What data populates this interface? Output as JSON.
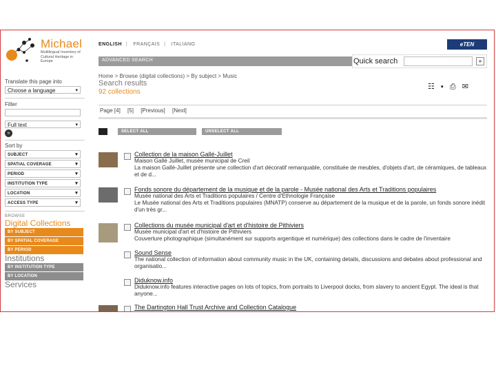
{
  "logo": {
    "name": "Michael",
    "tagline": "Multilingual Inventory of Cultural Heritage in Europe"
  },
  "languages": [
    {
      "label": "ENGLISH",
      "active": true
    },
    {
      "label": "FRANÇAIS",
      "active": false
    },
    {
      "label": "ITALIANO",
      "active": false
    }
  ],
  "header": {
    "advanced_search": "ADVANCED SEARCH",
    "eten_logo": "eTEN"
  },
  "quick_search": {
    "label": "Quick search",
    "button": "»"
  },
  "sidebar": {
    "translate_label": "Translate this page into",
    "language_select": "Choose a language",
    "filter_label": "Filter",
    "filter_select": "Full text",
    "go": "»",
    "sort_label": "Sort by",
    "sort_options": [
      "SUBJECT",
      "SPATIAL COVERAGE",
      "PERIOD",
      "INSTITUTION TYPE",
      "LOCATION",
      "ACCESS TYPE"
    ],
    "browse_label": "BROWSE",
    "digital_collections": "Digital Collections",
    "dc_buttons": [
      "BY SUBJECT",
      "BY SPATIAL COVERAGE",
      "BY PERIOD"
    ],
    "institutions": "Institutions",
    "inst_buttons": [
      "BY INSTITUTION TYPE",
      "BY LOCATION"
    ],
    "services": "Services"
  },
  "breadcrumb": "Home > Browse (digital collections) > By subject > Music",
  "results": {
    "title": "Search results",
    "count": "92 collections",
    "pager": [
      "Page [4]",
      "[5]",
      "[Previous]",
      "[Next]"
    ],
    "select_all": "SELECT ALL",
    "unselect_all": "UNSELECT ALL",
    "tools": "☷ ▪ ⎙ ✉",
    "items": [
      {
        "title": "Collection de la maison Gallé-Juillet",
        "line1": "Maison Gallé Juillet, musée municipal de Creil",
        "line2": "La maison Gallé-Juillet présente une collection d'art décoratif remarquable, constituée de meubles, d'objets d'art, de céramiques, de tableaux et de d...",
        "thumb": true
      },
      {
        "title": "Fonds sonore du département de la musique et de la parole - Musée national des Arts et Traditions populaires",
        "line1": "Musée national des Arts et Traditions populaires / Centre d'Ethnologie Française",
        "line2": "Le Musée national des Arts et Traditions populaires (MNATP) conserve au département de la musique et de la parole, un fonds sonore inédit d'un très gr...",
        "thumb": true
      },
      {
        "title": "Collections du musée municipal d'art et d'histoire de Pithiviers",
        "line1": "Musée municipal d'art et d'histoire de Pithiviers",
        "line2": "Couverture photographique (simultanément sur supports argentique et numérique) des collections dans le cadre de l'inventaire",
        "thumb": true
      },
      {
        "title": "Sound Sense",
        "line1": "The national collection of information about community music in the UK, containing details, discussions and debates about professional and organisatio...",
        "line2": "",
        "thumb": false
      },
      {
        "title": "Diduknow.info",
        "line1": "Diduknow.info features interactive pages on lots of topics, from portraits to Liverpool docks, from slavery to ancient Egypt. The ideal is that anyone...",
        "line2": "",
        "thumb": false
      },
      {
        "title": "The Dartington Hall Trust Archive and Collection Catalogue",
        "line1": "",
        "line2": "",
        "thumb": true
      }
    ]
  },
  "colors": {
    "accent": "#e8891c",
    "frame": "#d23a3a",
    "grey_button": "#9b9b9b"
  }
}
